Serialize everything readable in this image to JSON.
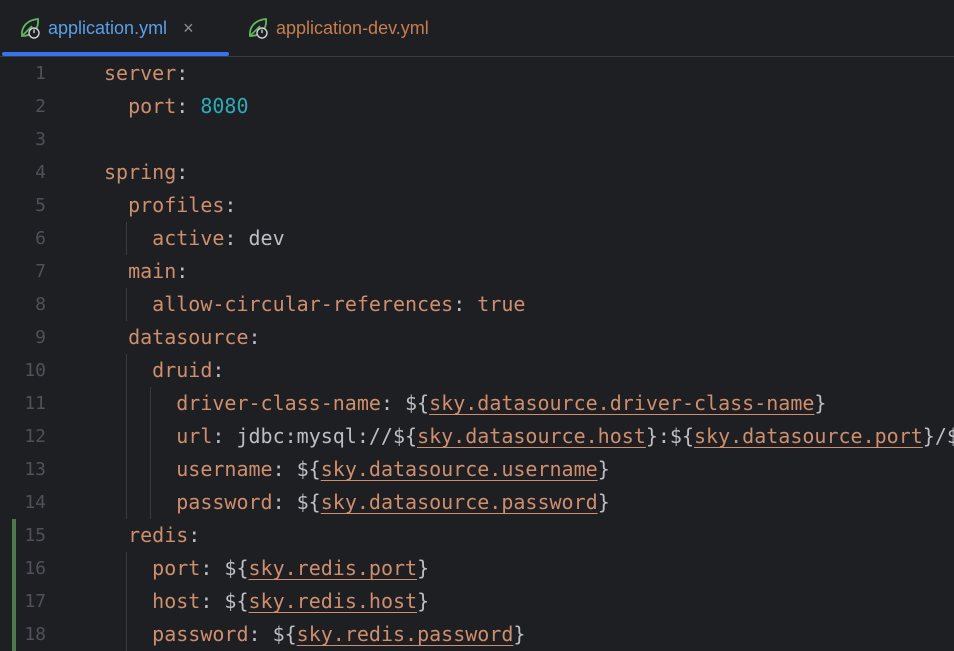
{
  "tabs": [
    {
      "label": "application.yml",
      "active": true,
      "icon": "spring-leaf-icon"
    },
    {
      "label": "application-dev.yml",
      "active": false,
      "icon": "spring-leaf-icon"
    }
  ],
  "close_glyph": "×",
  "colors": {
    "background": "#1e1f22",
    "key": "#cf8e6d",
    "number": "#2aacb8",
    "text": "#bcbec4",
    "active_tab_text": "#5a9fe8",
    "active_tab_underline": "#3574f0",
    "line_number": "#4e5157",
    "change_marker": "#4e7a4a"
  },
  "lines": [
    {
      "num": "1",
      "indent": 0,
      "parts": [
        {
          "t": "server",
          "c": "k"
        },
        {
          "t": ":",
          "c": "p"
        }
      ]
    },
    {
      "num": "2",
      "indent": 1,
      "parts": [
        {
          "t": "port",
          "c": "k"
        },
        {
          "t": ": ",
          "c": "p"
        },
        {
          "t": "8080",
          "c": "n"
        }
      ]
    },
    {
      "num": "3",
      "indent": 0,
      "parts": []
    },
    {
      "num": "4",
      "indent": 0,
      "parts": [
        {
          "t": "spring",
          "c": "k"
        },
        {
          "t": ":",
          "c": "p"
        }
      ]
    },
    {
      "num": "5",
      "indent": 1,
      "parts": [
        {
          "t": "profiles",
          "c": "k"
        },
        {
          "t": ":",
          "c": "p"
        }
      ]
    },
    {
      "num": "6",
      "indent": 2,
      "parts": [
        {
          "t": "active",
          "c": "k"
        },
        {
          "t": ": ",
          "c": "p"
        },
        {
          "t": "dev",
          "c": "v"
        }
      ]
    },
    {
      "num": "7",
      "indent": 1,
      "parts": [
        {
          "t": "main",
          "c": "k"
        },
        {
          "t": ":",
          "c": "p"
        }
      ]
    },
    {
      "num": "8",
      "indent": 2,
      "parts": [
        {
          "t": "allow-circular-references",
          "c": "k"
        },
        {
          "t": ": ",
          "c": "p"
        },
        {
          "t": "true",
          "c": "k"
        }
      ]
    },
    {
      "num": "9",
      "indent": 1,
      "parts": [
        {
          "t": "datasource",
          "c": "k"
        },
        {
          "t": ":",
          "c": "p"
        }
      ]
    },
    {
      "num": "10",
      "indent": 2,
      "parts": [
        {
          "t": "druid",
          "c": "k"
        },
        {
          "t": ":",
          "c": "p"
        }
      ]
    },
    {
      "num": "11",
      "indent": 3,
      "parts": [
        {
          "t": "driver-class-name",
          "c": "k"
        },
        {
          "t": ": ${",
          "c": "p"
        },
        {
          "t": "sky.datasource.driver-class-name",
          "c": "ref"
        },
        {
          "t": "}",
          "c": "p"
        }
      ]
    },
    {
      "num": "12",
      "indent": 3,
      "parts": [
        {
          "t": "url",
          "c": "k"
        },
        {
          "t": ": jdbc:mysql://${",
          "c": "p"
        },
        {
          "t": "sky.datasource.host",
          "c": "ref"
        },
        {
          "t": "}:${",
          "c": "p"
        },
        {
          "t": "sky.datasource.port",
          "c": "ref"
        },
        {
          "t": "}/$",
          "c": "p"
        }
      ]
    },
    {
      "num": "13",
      "indent": 3,
      "parts": [
        {
          "t": "username",
          "c": "k"
        },
        {
          "t": ": ${",
          "c": "p"
        },
        {
          "t": "sky.datasource.username",
          "c": "ref"
        },
        {
          "t": "}",
          "c": "p"
        }
      ]
    },
    {
      "num": "14",
      "indent": 3,
      "parts": [
        {
          "t": "password",
          "c": "k"
        },
        {
          "t": ": ${",
          "c": "p"
        },
        {
          "t": "sky.datasource.password",
          "c": "ref"
        },
        {
          "t": "}",
          "c": "p"
        }
      ]
    },
    {
      "num": "15",
      "indent": 1,
      "changed": true,
      "parts": [
        {
          "t": "redis",
          "c": "k"
        },
        {
          "t": ":",
          "c": "p"
        }
      ]
    },
    {
      "num": "16",
      "indent": 2,
      "changed": true,
      "parts": [
        {
          "t": "port",
          "c": "k"
        },
        {
          "t": ": ${",
          "c": "p"
        },
        {
          "t": "sky.redis.port",
          "c": "ref"
        },
        {
          "t": "}",
          "c": "p"
        }
      ]
    },
    {
      "num": "17",
      "indent": 2,
      "changed": true,
      "parts": [
        {
          "t": "host",
          "c": "k"
        },
        {
          "t": ": ${",
          "c": "p"
        },
        {
          "t": "sky.redis.host",
          "c": "ref"
        },
        {
          "t": "}",
          "c": "p"
        }
      ]
    },
    {
      "num": "18",
      "indent": 2,
      "changed": true,
      "parts": [
        {
          "t": "password",
          "c": "k"
        },
        {
          "t": ": ${",
          "c": "p"
        },
        {
          "t": "sky.redis.password",
          "c": "ref"
        },
        {
          "t": "}",
          "c": "p"
        }
      ]
    }
  ]
}
